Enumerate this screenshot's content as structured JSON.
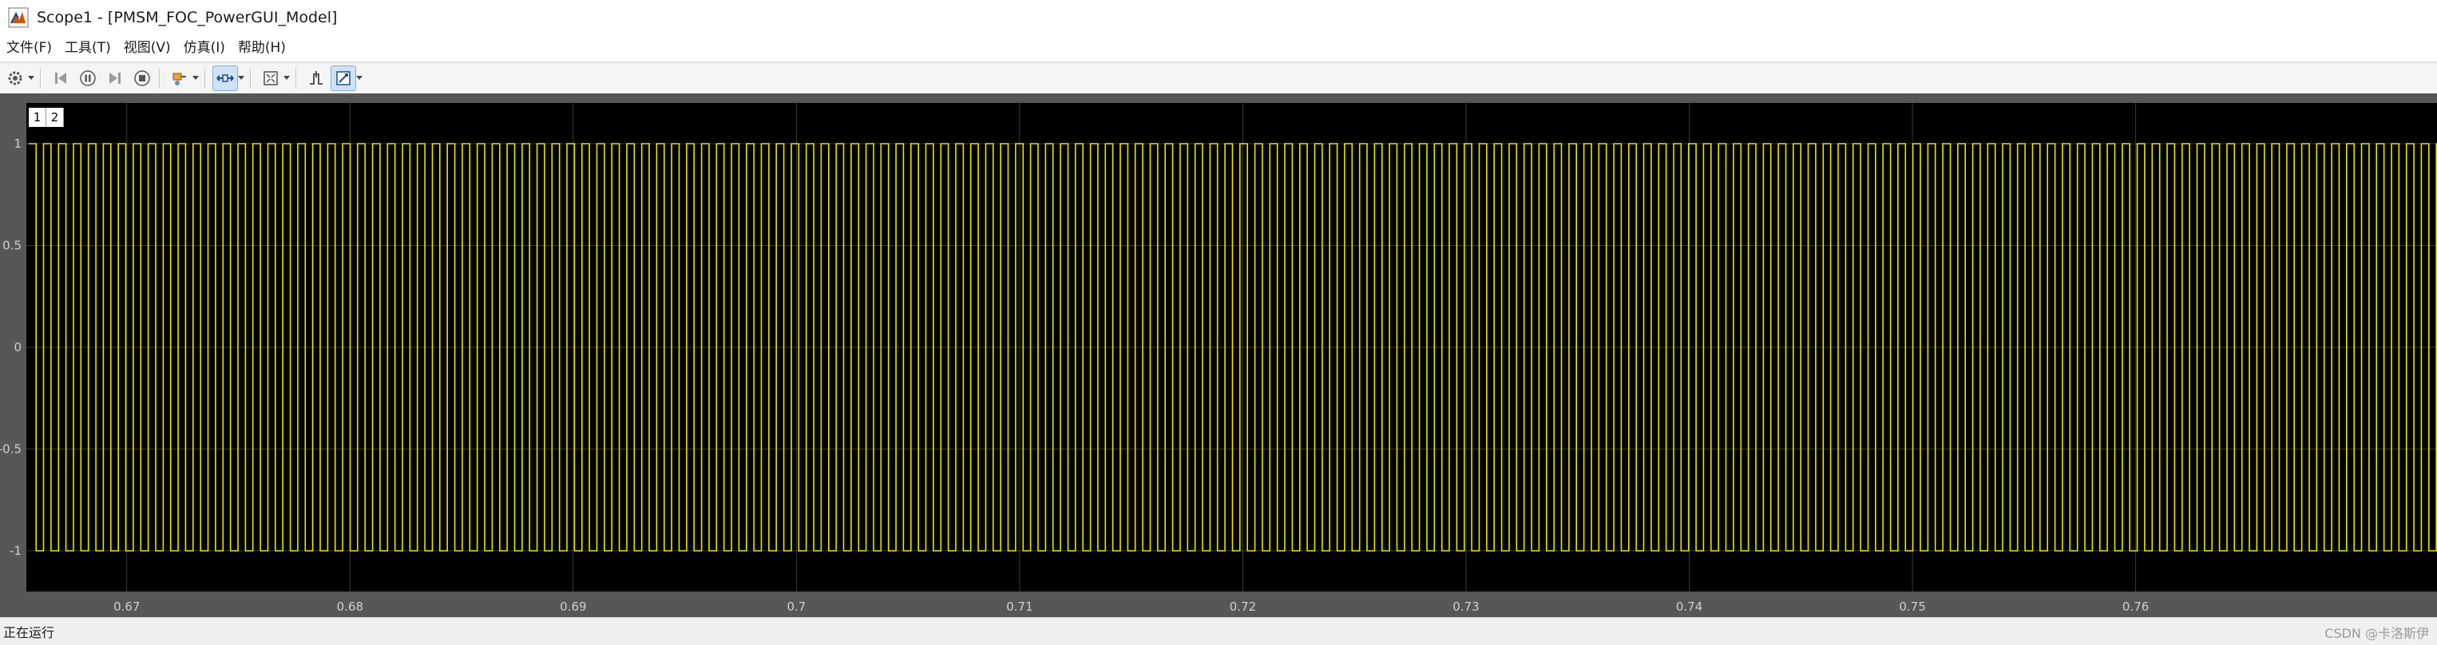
{
  "window": {
    "title": "Scope1 - [PMSM_FOC_PowerGUI_Model]"
  },
  "menu": {
    "items": [
      {
        "label": "文件(F)"
      },
      {
        "label": "工具(T)"
      },
      {
        "label": "视图(V)"
      },
      {
        "label": "仿真(I)"
      },
      {
        "label": "帮助(H)"
      }
    ]
  },
  "toolbar": {
    "buttons": [
      {
        "icon": "gear-icon",
        "dropdown": true
      },
      {
        "icon": "step-back-icon"
      },
      {
        "icon": "pause-icon"
      },
      {
        "icon": "step-forward-icon"
      },
      {
        "icon": "stop-icon"
      },
      {
        "icon": "highlight-simulink-block-icon",
        "dropdown": true
      },
      {
        "icon": "zoom-x-icon",
        "dropdown": true,
        "active": true
      },
      {
        "icon": "autoscale-icon",
        "dropdown": true
      },
      {
        "icon": "triggers-icon"
      },
      {
        "icon": "cursor-measurements-icon",
        "dropdown": true,
        "active": true
      }
    ]
  },
  "layout_tabs": [
    "1",
    "2"
  ],
  "colors": {
    "plot_bg": "#000000",
    "figure_bg": "#575757",
    "grid": "#3a3a3a",
    "signal": "#e6e600",
    "tick_text": "#d0d0d0"
  },
  "status": {
    "text": "正在运行",
    "watermark": "CSDN @卡洛斯伊"
  },
  "chart_data": {
    "type": "line",
    "title": "",
    "xlabel": "",
    "ylabel": "",
    "xlim": [
      0.6655,
      0.7735
    ],
    "ylim": [
      -1.2,
      1.2
    ],
    "grid": true,
    "x_ticks": [
      "0.67",
      "0.68",
      "0.69",
      "0.7",
      "0.71",
      "0.72",
      "0.73",
      "0.74",
      "0.75",
      "0.76"
    ],
    "y_ticks": [
      "1",
      "0.5",
      "0",
      "-0.5",
      "-1"
    ],
    "series": [
      {
        "shape": "square-wave",
        "high": 1,
        "low": -1,
        "period": 0.00067,
        "duty": 0.5,
        "phase_start": 0.6656
      }
    ]
  }
}
